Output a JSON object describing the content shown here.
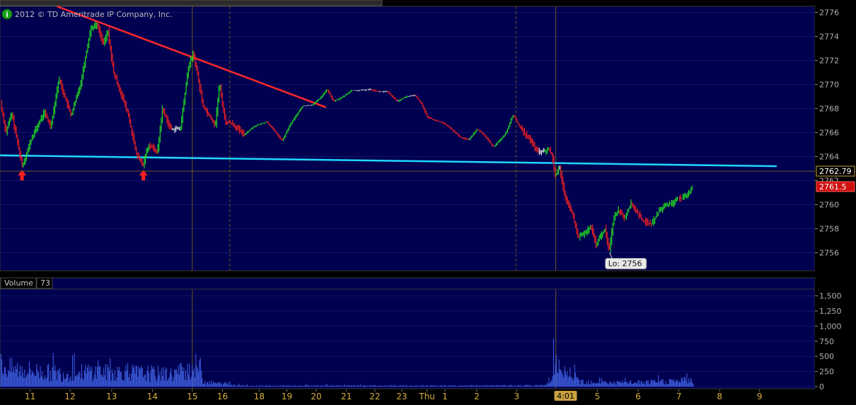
{
  "header": {
    "copyright": "2012 © TD Ameritrade IP Company, Inc.",
    "info_icon": "info-icon"
  },
  "colors": {
    "plot_bg": "#000050",
    "up": "#22dd22",
    "down": "#ee2020",
    "flat": "#e0e0e0",
    "grid": "#6a5a20",
    "axis_text": "#b0b0b0",
    "date_text": "#d8b040",
    "trendline_red": "#ff2a2a",
    "trendline_cyan": "#20d8ff",
    "arrow": "#ff2020",
    "volume": "#3a5ad8"
  },
  "chart_data": [
    {
      "type": "candlestick",
      "title": "",
      "ylim": [
        2754.5,
        2776.5
      ],
      "ytick_labels": [
        "2776",
        "2774",
        "2772",
        "2770",
        "2768",
        "2766",
        "2764",
        "2762",
        "2760",
        "2758",
        "2756"
      ],
      "price_tags": [
        {
          "label": "2762.79",
          "value": 2762.79,
          "style": "neutral"
        },
        {
          "label": "2761.5",
          "value": 2761.5,
          "style": "current"
        }
      ],
      "annotation": {
        "label": "Lo: 2756",
        "value": 2756
      },
      "trendlines": [
        {
          "name": "resistance",
          "color": "red",
          "from": {
            "x": 0.07,
            "y": 2776.5
          },
          "to": {
            "x": 0.4,
            "y": 2768.1
          }
        },
        {
          "name": "support",
          "color": "cyan",
          "from": {
            "x": 0.0,
            "y": 2764.1
          },
          "to": {
            "x": 0.953,
            "y": 2763.2
          }
        }
      ],
      "markers": [
        {
          "type": "up-arrow",
          "x": 0.027,
          "y": 2762.9
        },
        {
          "type": "up-arrow",
          "x": 0.176,
          "y": 2762.9
        }
      ],
      "session_break": {
        "label": "4:01",
        "x": 0.682
      },
      "price_path": [
        [
          0.0,
          2769
        ],
        [
          0.008,
          2766
        ],
        [
          0.015,
          2767.6
        ],
        [
          0.028,
          2763.2
        ],
        [
          0.04,
          2765.6
        ],
        [
          0.055,
          2767.7
        ],
        [
          0.063,
          2766.5
        ],
        [
          0.073,
          2770.5
        ],
        [
          0.082,
          2768.6
        ],
        [
          0.088,
          2767.4
        ],
        [
          0.1,
          2770.2
        ],
        [
          0.112,
          2774.7
        ],
        [
          0.12,
          2775
        ],
        [
          0.128,
          2773.3
        ],
        [
          0.133,
          2774.5
        ],
        [
          0.14,
          2771
        ],
        [
          0.148,
          2769.5
        ],
        [
          0.158,
          2767.5
        ],
        [
          0.168,
          2764.2
        ],
        [
          0.176,
          2763.3
        ],
        [
          0.183,
          2765
        ],
        [
          0.194,
          2764.4
        ],
        [
          0.2,
          2768
        ],
        [
          0.21,
          2766.3
        ],
        [
          0.222,
          2766.3
        ],
        [
          0.232,
          2771.5
        ],
        [
          0.238,
          2772.6
        ],
        [
          0.243,
          2770.8
        ],
        [
          0.25,
          2768.2
        ],
        [
          0.258,
          2767.4
        ],
        [
          0.265,
          2766.6
        ],
        [
          0.27,
          2770.1
        ],
        [
          0.277,
          2766.9
        ],
        [
          0.285,
          2766.8
        ],
        [
          0.3,
          2765.8
        ],
        [
          0.312,
          2766.5
        ],
        [
          0.328,
          2766.9
        ],
        [
          0.338,
          2766.1
        ],
        [
          0.347,
          2765.3
        ],
        [
          0.357,
          2766.7
        ],
        [
          0.372,
          2768.2
        ],
        [
          0.384,
          2768.3
        ],
        [
          0.394,
          2768.9
        ],
        [
          0.402,
          2769.6
        ],
        [
          0.41,
          2768.6
        ],
        [
          0.42,
          2768.9
        ],
        [
          0.432,
          2769.5
        ],
        [
          0.443,
          2769.5
        ],
        [
          0.455,
          2769.6
        ],
        [
          0.465,
          2769.4
        ],
        [
          0.476,
          2769.4
        ],
        [
          0.488,
          2768.6
        ],
        [
          0.5,
          2769
        ],
        [
          0.51,
          2769.1
        ],
        [
          0.518,
          2768.4
        ],
        [
          0.525,
          2767.3
        ],
        [
          0.535,
          2767
        ],
        [
          0.545,
          2766.8
        ],
        [
          0.556,
          2766.2
        ],
        [
          0.566,
          2765.6
        ],
        [
          0.576,
          2765.4
        ],
        [
          0.586,
          2766.3
        ],
        [
          0.596,
          2765.7
        ],
        [
          0.606,
          2764.8
        ],
        [
          0.616,
          2765.5
        ],
        [
          0.622,
          2766
        ],
        [
          0.63,
          2767.5
        ],
        [
          0.64,
          2766.3
        ],
        [
          0.65,
          2765.5
        ],
        [
          0.66,
          2764.4
        ],
        [
          0.668,
          2764.4
        ],
        [
          0.674,
          2764.6
        ],
        [
          0.678,
          2764.2
        ],
        [
          0.682,
          2762.3
        ],
        [
          0.687,
          2763.3
        ],
        [
          0.694,
          2760.5
        ],
        [
          0.702,
          2759.5
        ],
        [
          0.71,
          2757.3
        ],
        [
          0.718,
          2757.6
        ],
        [
          0.726,
          2758.1
        ],
        [
          0.732,
          2756.7
        ],
        [
          0.738,
          2757.4
        ],
        [
          0.743,
          2758
        ],
        [
          0.748,
          2756.1
        ],
        [
          0.754,
          2759
        ],
        [
          0.76,
          2759.6
        ],
        [
          0.767,
          2758.9
        ],
        [
          0.775,
          2760.1
        ],
        [
          0.783,
          2759.3
        ],
        [
          0.79,
          2758.6
        ],
        [
          0.8,
          2758.4
        ],
        [
          0.81,
          2759.5
        ],
        [
          0.818,
          2760
        ],
        [
          0.826,
          2760.1
        ],
        [
          0.832,
          2760.6
        ],
        [
          0.838,
          2760.5
        ],
        [
          0.845,
          2760.8
        ],
        [
          0.85,
          2761.5
        ]
      ]
    },
    {
      "type": "bar",
      "title": "Volume",
      "latest_value_label": "73",
      "ylim": [
        0,
        1600
      ],
      "ytick_labels": [
        "1,500",
        "1,250",
        "1,000",
        "750",
        "500",
        "250",
        "0"
      ],
      "profile": [
        [
          0.0,
          520
        ],
        [
          0.01,
          420
        ],
        [
          0.03,
          390
        ],
        [
          0.06,
          330
        ],
        [
          0.09,
          300
        ],
        [
          0.11,
          360
        ],
        [
          0.13,
          330
        ],
        [
          0.15,
          350
        ],
        [
          0.17,
          320
        ],
        [
          0.19,
          310
        ],
        [
          0.21,
          290
        ],
        [
          0.23,
          420
        ],
        [
          0.245,
          500
        ],
        [
          0.25,
          110
        ],
        [
          0.27,
          70
        ],
        [
          0.3,
          20
        ],
        [
          0.4,
          22
        ],
        [
          0.5,
          20
        ],
        [
          0.6,
          22
        ],
        [
          0.67,
          30
        ],
        [
          0.682,
          520
        ],
        [
          0.69,
          200
        ],
        [
          0.7,
          320
        ],
        [
          0.71,
          130
        ],
        [
          0.75,
          90
        ],
        [
          0.8,
          100
        ],
        [
          0.85,
          160
        ],
        [
          0.852,
          0
        ]
      ]
    }
  ],
  "x_axis": {
    "labels": [
      {
        "text": "11",
        "x": 0.037
      },
      {
        "text": "12",
        "x": 0.086
      },
      {
        "text": "13",
        "x": 0.137
      },
      {
        "text": "14",
        "x": 0.187
      },
      {
        "text": "15",
        "x": 0.236
      },
      {
        "text": "16",
        "x": 0.273
      },
      {
        "text": "18",
        "x": 0.318
      },
      {
        "text": "19",
        "x": 0.352
      },
      {
        "text": "20",
        "x": 0.388
      },
      {
        "text": "21",
        "x": 0.425
      },
      {
        "text": "22",
        "x": 0.46
      },
      {
        "text": "23",
        "x": 0.493
      },
      {
        "text": "Thu",
        "x": 0.524
      },
      {
        "text": "1",
        "x": 0.546
      },
      {
        "text": "2",
        "x": 0.585
      },
      {
        "text": "3",
        "x": 0.634
      },
      {
        "text": "4:01",
        "x": 0.694
      },
      {
        "text": "5",
        "x": 0.733
      },
      {
        "text": "6",
        "x": 0.783
      },
      {
        "text": "7",
        "x": 0.833
      },
      {
        "text": "8",
        "x": 0.883
      },
      {
        "text": "9",
        "x": 0.932
      }
    ],
    "major_breaks": [
      0.236,
      0.682
    ],
    "minor_breaks": [
      0.282,
      0.633
    ]
  }
}
